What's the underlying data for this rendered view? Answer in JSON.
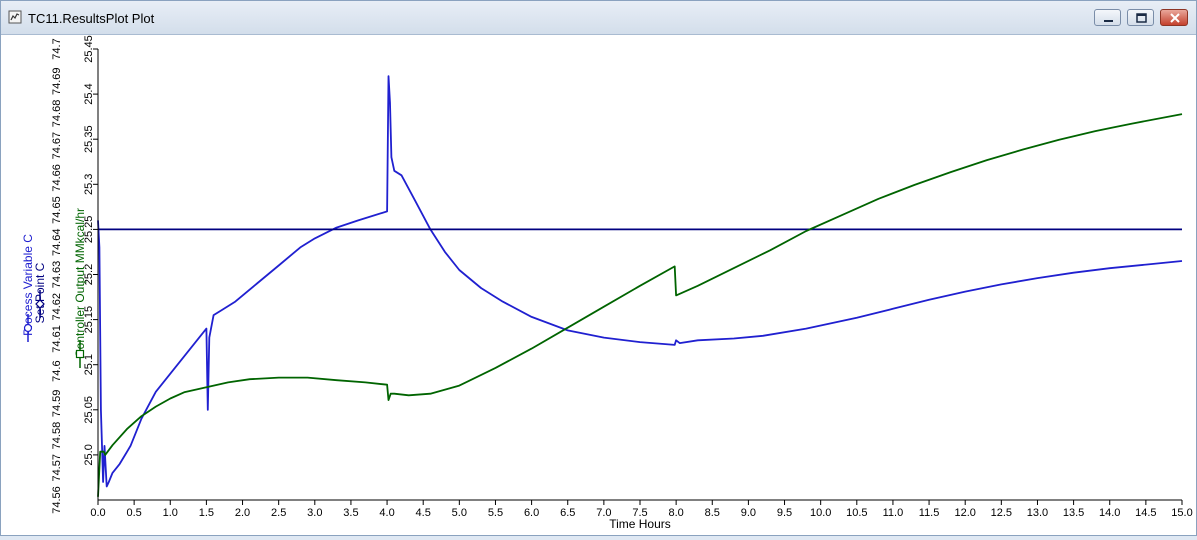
{
  "window": {
    "title": "TC11.ResultsPlot Plot",
    "controls": [
      "minimize",
      "maximize",
      "close"
    ]
  },
  "chart_data": {
    "type": "line",
    "xlabel": "Time Hours",
    "xlim": [
      0,
      15
    ],
    "xticks": [
      "0.0",
      "0.5",
      "1.0",
      "1.5",
      "2.0",
      "2.5",
      "3.0",
      "3.5",
      "4.0",
      "4.5",
      "5.0",
      "5.5",
      "6.0",
      "6.5",
      "7.0",
      "7.5",
      "8.0",
      "8.5",
      "9.0",
      "9.5",
      "10.0",
      "10.5",
      "11.0",
      "11.5",
      "12.0",
      "12.5",
      "13.0",
      "13.5",
      "14.0",
      "14.5",
      "15.0"
    ],
    "axes": [
      {
        "label": "Process Variable C",
        "color": "#2020d0",
        "marker": "circle",
        "ylim": [
          24.95,
          25.45
        ],
        "ticks": [
          "25.0",
          "25.05",
          "25.1",
          "25.15",
          "25.2",
          "25.25",
          "25.3",
          "25.35",
          "25.4",
          "25.45"
        ]
      },
      {
        "label": "Set Point C",
        "color": "#000080",
        "marker": "diamond",
        "ylim": [
          24.95,
          25.45
        ]
      },
      {
        "label": "Controller Output MMkcal/hr",
        "color": "#006400",
        "marker": "square",
        "ylim": [
          74.56,
          74.7
        ],
        "ticks": [
          "74.56",
          "74.57",
          "74.58",
          "74.59",
          "74.6",
          "74.61",
          "74.62",
          "74.63",
          "74.64",
          "74.65",
          "74.66",
          "74.67",
          "74.68",
          "74.69",
          "74.7"
        ]
      }
    ],
    "series": [
      {
        "name": "Process Variable C",
        "color": "#2020d0",
        "axis": 0,
        "points": [
          [
            0,
            25.26
          ],
          [
            0.02,
            25.23
          ],
          [
            0.04,
            25.05
          ],
          [
            0.07,
            24.97
          ],
          [
            0.09,
            25.01
          ],
          [
            0.12,
            24.965
          ],
          [
            0.15,
            24.97
          ],
          [
            0.2,
            24.98
          ],
          [
            0.3,
            24.99
          ],
          [
            0.45,
            25.01
          ],
          [
            0.6,
            25.04
          ],
          [
            0.8,
            25.07
          ],
          [
            1.0,
            25.09
          ],
          [
            1.2,
            25.11
          ],
          [
            1.4,
            25.13
          ],
          [
            1.5,
            25.14
          ],
          [
            1.52,
            25.05
          ],
          [
            1.54,
            25.13
          ],
          [
            1.6,
            25.155
          ],
          [
            1.7,
            25.16
          ],
          [
            1.9,
            25.17
          ],
          [
            2.2,
            25.19
          ],
          [
            2.5,
            25.21
          ],
          [
            2.8,
            25.23
          ],
          [
            3.0,
            25.24
          ],
          [
            3.3,
            25.252
          ],
          [
            3.6,
            25.26
          ],
          [
            4.0,
            25.27
          ],
          [
            4.02,
            25.42
          ],
          [
            4.04,
            25.39
          ],
          [
            4.06,
            25.33
          ],
          [
            4.1,
            25.315
          ],
          [
            4.2,
            25.31
          ],
          [
            4.4,
            25.28
          ],
          [
            4.6,
            25.25
          ],
          [
            4.8,
            25.225
          ],
          [
            5.0,
            25.205
          ],
          [
            5.3,
            25.185
          ],
          [
            5.6,
            25.17
          ],
          [
            6.0,
            25.153
          ],
          [
            6.5,
            25.138
          ],
          [
            7.0,
            25.13
          ],
          [
            7.5,
            25.125
          ],
          [
            7.98,
            25.122
          ],
          [
            8.0,
            25.127
          ],
          [
            8.05,
            25.124
          ],
          [
            8.3,
            25.127
          ],
          [
            8.8,
            25.129
          ],
          [
            9.2,
            25.132
          ],
          [
            9.8,
            25.14
          ],
          [
            10.5,
            25.152
          ],
          [
            11.0,
            25.162
          ],
          [
            11.5,
            25.172
          ],
          [
            12.0,
            25.181
          ],
          [
            12.5,
            25.189
          ],
          [
            13.0,
            25.196
          ],
          [
            13.5,
            25.202
          ],
          [
            14.0,
            25.207
          ],
          [
            14.5,
            25.211
          ],
          [
            15.0,
            25.215
          ]
        ]
      },
      {
        "name": "Set Point C",
        "color": "#000080",
        "axis": 1,
        "points": [
          [
            0,
            25.25
          ],
          [
            15,
            25.25
          ]
        ]
      },
      {
        "name": "Controller Output MMkcal/hr",
        "color": "#006400",
        "axis": 2,
        "points": [
          [
            0,
            74.561
          ],
          [
            0.03,
            74.575
          ],
          [
            0.08,
            74.575
          ],
          [
            0.1,
            74.574
          ],
          [
            0.2,
            74.577
          ],
          [
            0.4,
            74.582
          ],
          [
            0.6,
            74.586
          ],
          [
            0.8,
            74.589
          ],
          [
            1.0,
            74.5915
          ],
          [
            1.2,
            74.5935
          ],
          [
            1.5,
            74.595
          ],
          [
            1.8,
            74.5965
          ],
          [
            2.1,
            74.5975
          ],
          [
            2.5,
            74.598
          ],
          [
            2.9,
            74.598
          ],
          [
            3.3,
            74.5972
          ],
          [
            3.7,
            74.5965
          ],
          [
            4.0,
            74.5958
          ],
          [
            4.02,
            74.591
          ],
          [
            4.05,
            74.593
          ],
          [
            4.1,
            74.593
          ],
          [
            4.3,
            74.5925
          ],
          [
            4.6,
            74.593
          ],
          [
            5.0,
            74.5955
          ],
          [
            5.5,
            74.601
          ],
          [
            6.0,
            74.607
          ],
          [
            6.5,
            74.6135
          ],
          [
            7.0,
            74.62
          ],
          [
            7.5,
            74.6265
          ],
          [
            7.98,
            74.6325
          ],
          [
            8.0,
            74.6235
          ],
          [
            8.3,
            74.6265
          ],
          [
            8.8,
            74.632
          ],
          [
            9.3,
            74.6375
          ],
          [
            9.8,
            74.6435
          ],
          [
            10.3,
            74.6485
          ],
          [
            10.8,
            74.6535
          ],
          [
            11.3,
            74.6578
          ],
          [
            11.8,
            74.6618
          ],
          [
            12.3,
            74.6655
          ],
          [
            12.8,
            74.6688
          ],
          [
            13.3,
            74.6718
          ],
          [
            13.8,
            74.6745
          ],
          [
            14.3,
            74.6768
          ],
          [
            15.0,
            74.6798
          ]
        ]
      }
    ]
  }
}
